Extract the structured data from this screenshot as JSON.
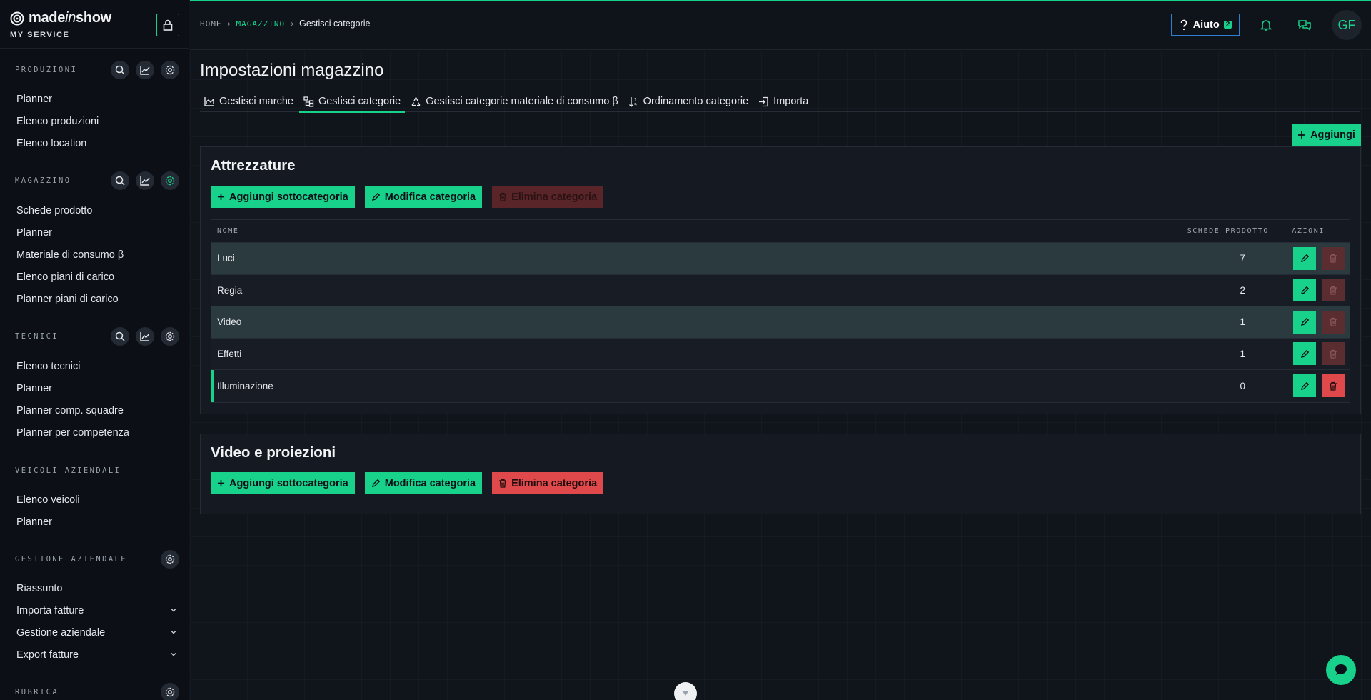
{
  "brand": {
    "name_plain": "made",
    "name_italic": "in",
    "name_tail": "show",
    "subtitle": "MY SERVICE"
  },
  "sidebar": {
    "sections": [
      {
        "title": "PRODUZIONI",
        "items": [
          "Planner",
          "Elenco produzioni",
          "Elenco location"
        ]
      },
      {
        "title": "MAGAZZINO",
        "items": [
          "Schede prodotto",
          "Planner",
          "Materiale di consumo β",
          "Elenco piani di carico",
          "Planner piani di carico"
        ]
      },
      {
        "title": "TECNICI",
        "items": [
          "Elenco tecnici",
          "Planner",
          "Planner comp. squadre",
          "Planner per competenza"
        ]
      },
      {
        "title": "VEICOLI AZIENDALI",
        "items": [
          "Elenco veicoli",
          "Planner"
        ]
      },
      {
        "title": "GESTIONE AZIENDALE",
        "items": [
          "Riassunto",
          "Importa fatture",
          "Gestione aziendale",
          "Export fatture"
        ]
      },
      {
        "title": "RUBRICA",
        "items": []
      }
    ]
  },
  "breadcrumb": {
    "home": "HOME",
    "section": "MAGAZZINO",
    "current": "Gestisci categorie"
  },
  "header": {
    "help_label": "Aiuto",
    "help_badge": "2",
    "avatar_initials": "GF"
  },
  "page": {
    "title": "Impostazioni magazzino",
    "tabs": [
      "Gestisci marche",
      "Gestisci categorie",
      "Gestisci categorie materiale di consumo β",
      "Ordinamento categorie",
      "Importa"
    ],
    "active_tab": "Gestisci categorie",
    "add_label": "Aggiungi"
  },
  "actions": {
    "add_sub": "Aggiungi sottocategoria",
    "edit": "Modifica categoria",
    "delete": "Elimina categoria"
  },
  "table_headers": {
    "name": "NOME",
    "count": "SCHEDE PRODOTTO",
    "actions": "AZIONI"
  },
  "categories": [
    {
      "title": "Attrezzature",
      "rows": [
        {
          "name": "Luci",
          "count": "7"
        },
        {
          "name": "Regia",
          "count": "2"
        },
        {
          "name": "Video",
          "count": "1"
        },
        {
          "name": "Effetti",
          "count": "1"
        },
        {
          "name": "Illuminazione",
          "count": "0"
        }
      ]
    },
    {
      "title": "Video e proiezioni",
      "rows": []
    }
  ],
  "colors": {
    "accent": "#18d28b",
    "danger": "#e0494b",
    "danger_dim": "#5a2529"
  }
}
